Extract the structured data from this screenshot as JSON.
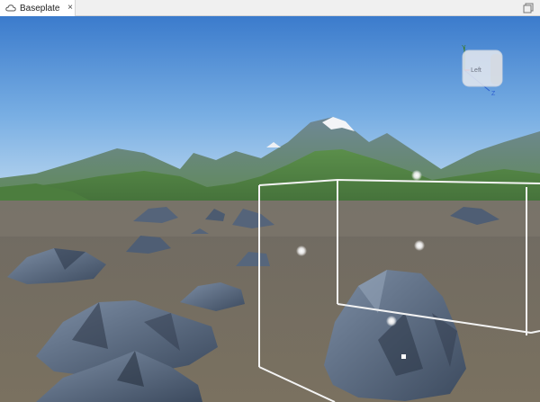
{
  "window": {
    "tab_label": "Baseplate",
    "tab_icon": "cloud-icon",
    "close_glyph": "×"
  },
  "view_cube": {
    "face_label": "Left",
    "axis_y": "Y",
    "axis_z": "Z"
  },
  "colors": {
    "sky_top": "#3e7fcf",
    "sky_bottom": "#a9ccec",
    "ground": "#7d7468",
    "grass": "#6b9a4a",
    "rock": "#52627a",
    "selection_box": "#ffffff"
  }
}
